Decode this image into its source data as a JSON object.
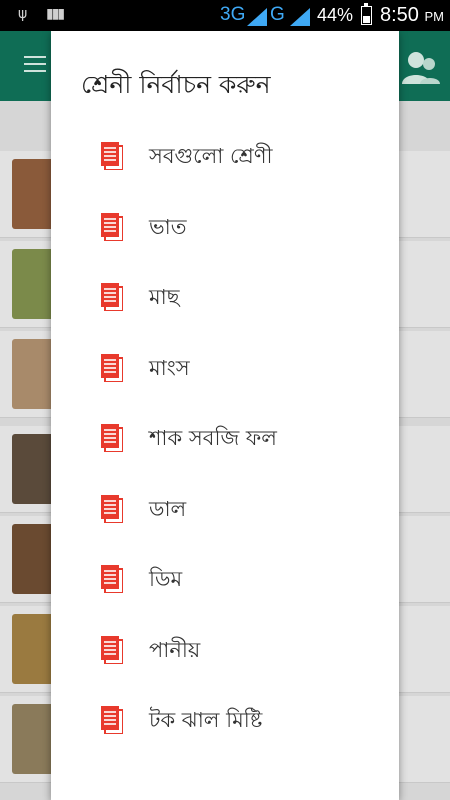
{
  "status_bar": {
    "network_3g": "3G",
    "network_g": "G",
    "battery_percent": "44%",
    "battery_level": 0.44,
    "time": "8:50",
    "ampm": "PM"
  },
  "dialog": {
    "title": "শ্রেনী নির্বাচন করুন",
    "items": [
      {
        "label": "সবগুলো শ্রেণী",
        "icon": "document-icon"
      },
      {
        "label": "ভাত",
        "icon": "document-icon"
      },
      {
        "label": "মাছ",
        "icon": "document-icon"
      },
      {
        "label": "মাংস",
        "icon": "document-icon"
      },
      {
        "label": "শাক সবজি ফল",
        "icon": "document-icon"
      },
      {
        "label": "ডাল",
        "icon": "document-icon"
      },
      {
        "label": "ডিম",
        "icon": "document-icon"
      },
      {
        "label": "পানীয়",
        "icon": "document-icon"
      },
      {
        "label": "টক ঝাল মিষ্টি",
        "icon": "document-icon"
      }
    ]
  },
  "colors": {
    "appbar": "#0f6d55",
    "icon_accent": "#e8392c"
  }
}
